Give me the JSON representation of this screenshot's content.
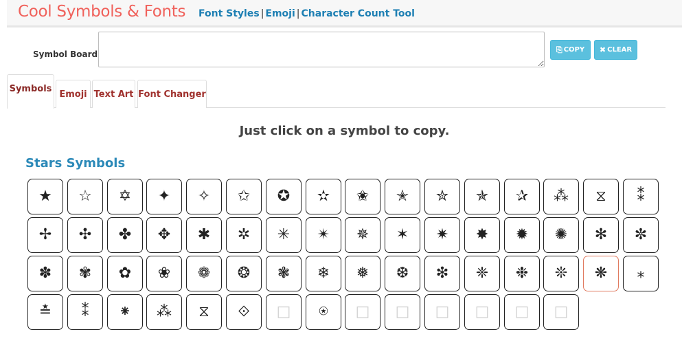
{
  "header": {
    "brand": "Cool Symbols & Fonts",
    "links": [
      "Font Styles",
      "Emoji",
      "Character Count Tool"
    ],
    "separator": "|"
  },
  "board": {
    "label": "Symbol Board",
    "value": "",
    "copy_label": "COPY",
    "clear_label": "CLEAR"
  },
  "tabs": [
    {
      "label": "Symbols",
      "active": true
    },
    {
      "label": "Emoji",
      "active": false
    },
    {
      "label": "Text Art",
      "active": false
    },
    {
      "label": "Font Changer",
      "active": false
    }
  ],
  "instruction": "Just click on a symbol to copy.",
  "section": {
    "title": "Stars Symbols",
    "rows": [
      [
        "★",
        "☆",
        "✡",
        "✦",
        "✧",
        "✩",
        "✪",
        "✫",
        "✬",
        "✭",
        "✮",
        "✯",
        "✰",
        "⁂",
        "⧖",
        "⁑"
      ],
      [
        "✢",
        "✣",
        "✤",
        "✥",
        "✱",
        "✲",
        "✳",
        "✴",
        "✵",
        "✶",
        "✷",
        "✸",
        "✹",
        "✺",
        "✻",
        "✼"
      ],
      [
        "✽",
        "✾",
        "✿",
        "❀",
        "❁",
        "❂",
        "❃",
        "❄",
        "❅",
        "❆",
        "❇",
        "❈",
        "❉",
        "❊",
        "❋",
        "⁎"
      ],
      [
        "≛",
        "⁑",
        "⁕",
        "⁂",
        "⧖",
        "⟐",
        "□",
        "⍟",
        "□",
        "□",
        "□",
        "□",
        "□",
        "□"
      ]
    ],
    "highlighted": [
      2,
      14
    ]
  },
  "colors": {
    "brand": "#f0615b",
    "link": "#1d7fb3",
    "button": "#5bc0de",
    "tab_text": "#a0322e",
    "section_title": "#2b89b8"
  }
}
